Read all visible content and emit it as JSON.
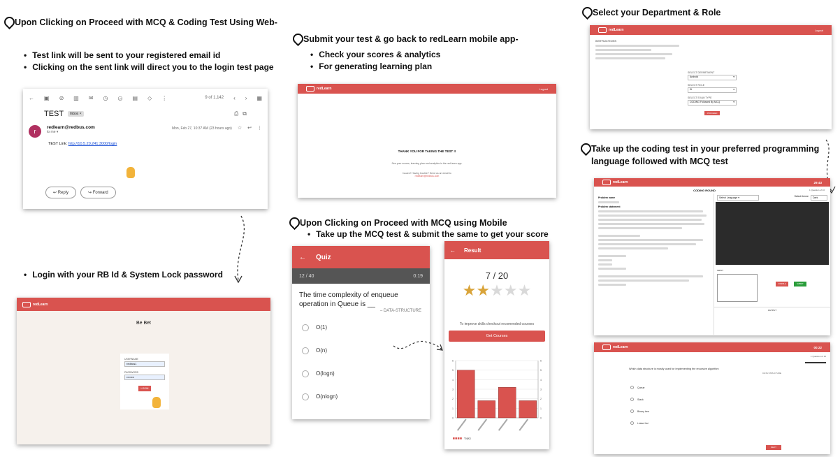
{
  "step1": {
    "heading": "Upon Clicking on Proceed with MCQ & Coding Test Using Web-",
    "bullets": [
      "Test link will be sent to your registered email id",
      "Clicking on the sent link will direct you to the login test page"
    ]
  },
  "email": {
    "toolbar_count": "9 of 1,142",
    "subject": "TEST",
    "badge": "Inbox ×",
    "avatar_letter": "r",
    "sender": "redlearn@redbus.com",
    "to": "to me ▾",
    "date": "Mon, Feb 27, 10:37 AM (23 hours ago)",
    "link_label": "TEST Link:",
    "link": "http://10.5.20.241:3000/login",
    "reply_label": "Reply",
    "forward_label": "Forward"
  },
  "step2": {
    "heading": "Login with your RB Id & System Lock password"
  },
  "login": {
    "logo": "redLearn",
    "title": "Be Bet",
    "username_label": "USERNAME",
    "username_value": "redbus1",
    "password_label": "PASSWORD",
    "password_value": "••••••••",
    "login_button": "LOGIN"
  },
  "step3": {
    "heading": "Submit your test & go back to redLearn mobile app-",
    "bullets": [
      "Check your scores & analytics",
      "For generating learning plan"
    ]
  },
  "thankyou": {
    "logo": "redLearn",
    "right_link": "Logout",
    "title": "THANK YOU FOR TAKING THE TEST !!",
    "line1": "See your scores, learning plan and analytics in the redLearn app.",
    "line2": "Issues? Having trouble? Send us an email to",
    "email": "redlearn@redbus.com"
  },
  "step4": {
    "heading": "Upon Clicking on Proceed with MCQ using Mobile",
    "bullets": [
      "Take up the MCQ test & submit the same to get your score"
    ]
  },
  "quiz": {
    "title": "Quiz",
    "progress": "12 / 40",
    "timer": "0:19",
    "question": "The time complexity of enqueue operation in Queue is __",
    "tag": "– DATA-STRUCTURE",
    "options": [
      "O(1)",
      "O(n)",
      "O(logn)",
      "O(nlogn)"
    ]
  },
  "result": {
    "title": "Result",
    "score": "7 / 20",
    "stars_filled": 2,
    "stars_total": 5,
    "improve_text": "To improve skills checkout recomended courses",
    "courses_button": "Get Courses",
    "legend": "Topics",
    "bar_color": "#d9534f"
  },
  "chart_data": {
    "type": "bar",
    "categories": [
      "",
      "",
      "",
      ""
    ],
    "values": [
      5,
      1.8,
      3.2,
      1.8
    ],
    "ylim": [
      0,
      6
    ],
    "legend": "Topics"
  },
  "step5": {
    "heading": "Select your Department & Role"
  },
  "dept": {
    "logo": "redLearn",
    "right_link": "Logout",
    "instructions_title": "INSTRUCTIONS",
    "fields": [
      {
        "label": "SELECT DEPARTMENT",
        "value": "Android"
      },
      {
        "label": "SELECT ROLE",
        "value": "I5"
      },
      {
        "label": "SELECT EXAM TYPE",
        "value": "CODING Followed By MCQ"
      }
    ],
    "button": "PROCEED"
  },
  "step6": {
    "heading_line1": "Take up the coding test in your preferred programming",
    "heading_line2": "language followed with MCQ test"
  },
  "coding": {
    "logo": "redLearn",
    "timer": "29:43",
    "title": "CODING ROUND",
    "question_count": "1 Question of 10",
    "problem_name_label": "Problem name",
    "problem_statement_label": "Problem statement",
    "select_language": "Select Language",
    "select_theme": "Select theme",
    "theme_value": "Dark",
    "input_label": "INPUT",
    "output_label": "OUTPUT",
    "compile_button": "COMPILE",
    "submit_button": "SUBMIT"
  },
  "mcqweb": {
    "logo": "redLearn",
    "timer": "00:22",
    "question_count": "1 Question of 10",
    "question": "Which data structure is mostly used for implementing the recursive algorithm",
    "tag": "DATA STRUCTURE",
    "options": [
      "Queue",
      "Stack",
      "Binary tree",
      "Linked list"
    ],
    "button": "NEXT"
  }
}
